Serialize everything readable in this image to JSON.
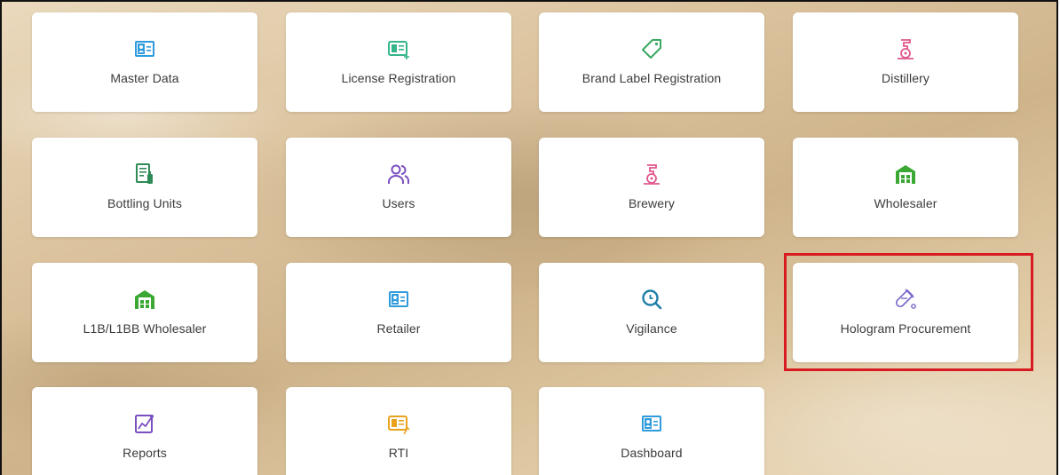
{
  "tiles": [
    {
      "label": "Master Data",
      "icon": "id-card-icon",
      "color": "#2f9bdc"
    },
    {
      "label": "License Registration",
      "icon": "id-card-plus-icon",
      "color": "#35b58a"
    },
    {
      "label": "Brand Label Registration",
      "icon": "tag-icon",
      "color": "#3aa862"
    },
    {
      "label": "Distillery",
      "icon": "distillery-icon",
      "color": "#e0578d"
    },
    {
      "label": "Bottling Units",
      "icon": "bottling-document-icon",
      "color": "#2e8b57"
    },
    {
      "label": "Users",
      "icon": "users-icon",
      "color": "#7a4fbf"
    },
    {
      "label": "Brewery",
      "icon": "brewery-icon",
      "color": "#e0578d"
    },
    {
      "label": "Wholesaler",
      "icon": "warehouse-icon",
      "color": "#3aa832"
    },
    {
      "label": "L1B/L1BB Wholesaler",
      "icon": "warehouse-icon",
      "color": "#3aa832"
    },
    {
      "label": "Retailer",
      "icon": "id-card-icon",
      "color": "#2f9bdc"
    },
    {
      "label": "Vigilance",
      "icon": "magnifier-icon",
      "color": "#1f7fa8"
    },
    {
      "label": "Hologram Procurement",
      "icon": "test-tube-icon",
      "color": "#7a67c9"
    },
    {
      "label": "Reports",
      "icon": "report-chart-icon",
      "color": "#7a4fbf"
    },
    {
      "label": "RTI",
      "icon": "rti-card-icon",
      "color": "#e8a21c"
    },
    {
      "label": "Dashboard",
      "icon": "id-card-icon",
      "color": "#2f9bdc"
    }
  ],
  "highlighted_tile": "Hologram Procurement",
  "highlight_color": "#d71b21"
}
